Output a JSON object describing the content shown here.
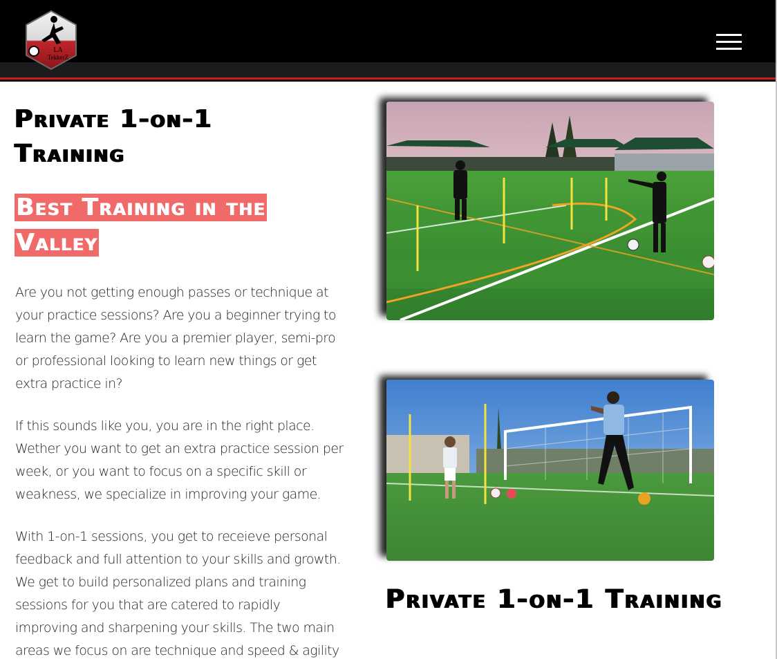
{
  "header": {
    "logo_text_line1": "LA",
    "logo_text_line2": "TekkerZ",
    "menu_icon": "hamburger-menu-icon",
    "colors": {
      "bar": "#000000",
      "accent": "#d11a1a"
    }
  },
  "main": {
    "title": "Private 1-on-1 Training",
    "highlight": "Best Training in the Valley",
    "highlight_color": "#f06a6a",
    "paragraphs": [
      "Are you not getting enough passes or technique at your practice sessions? Are you a beginner trying to learn the game? Are you a premier player, semi-pro or professional looking to learn new things or get extra practice in?",
      "If this sounds like you, you are in the right place. Wether you want to get an extra practice session per week, or you want to focus on a specific skill or weakness, we specialize in improving your game.",
      "With 1-on-1 sessions, you get to receieve personal feedback and full attention to your skills and growth. We get to build personalized plans and training sessions for you that are catered to rapidly improving and sharpening your skills. The two main areas we focus on are technique and speed & agility but are not limited to:"
    ]
  },
  "aside": {
    "photos": [
      "training-field-photo",
      "goal-practice-photo"
    ],
    "title": "Private 1-on-1 Training"
  }
}
